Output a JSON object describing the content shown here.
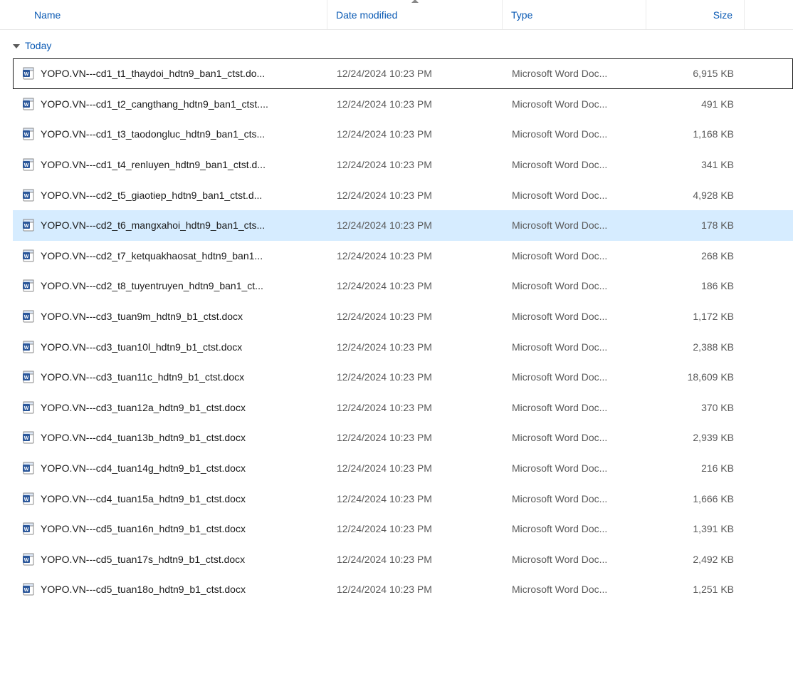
{
  "columns": {
    "name": "Name",
    "date": "Date modified",
    "type": "Type",
    "size": "Size",
    "sorted_column": "date",
    "sort_direction": "asc"
  },
  "group": {
    "label": "Today"
  },
  "file_type_display": "Microsoft Word Doc...",
  "files": [
    {
      "name": "YOPO.VN---cd1_t1_thaydoi_hdtn9_ban1_ctst.do...",
      "date": "12/24/2024 10:23 PM",
      "size": "6,915 KB",
      "state": "selected"
    },
    {
      "name": "YOPO.VN---cd1_t2_cangthang_hdtn9_ban1_ctst....",
      "date": "12/24/2024 10:23 PM",
      "size": "491 KB",
      "state": ""
    },
    {
      "name": "YOPO.VN---cd1_t3_taodongluc_hdtn9_ban1_cts...",
      "date": "12/24/2024 10:23 PM",
      "size": "1,168 KB",
      "state": ""
    },
    {
      "name": "YOPO.VN---cd1_t4_renluyen_hdtn9_ban1_ctst.d...",
      "date": "12/24/2024 10:23 PM",
      "size": "341 KB",
      "state": ""
    },
    {
      "name": "YOPO.VN---cd2_t5_giaotiep_hdtn9_ban1_ctst.d...",
      "date": "12/24/2024 10:23 PM",
      "size": "4,928 KB",
      "state": ""
    },
    {
      "name": "YOPO.VN---cd2_t6_mangxahoi_hdtn9_ban1_cts...",
      "date": "12/24/2024 10:23 PM",
      "size": "178 KB",
      "state": "hovered"
    },
    {
      "name": "YOPO.VN---cd2_t7_ketquakhaosat_hdtn9_ban1...",
      "date": "12/24/2024 10:23 PM",
      "size": "268 KB",
      "state": ""
    },
    {
      "name": "YOPO.VN---cd2_t8_tuyentruyen_hdtn9_ban1_ct...",
      "date": "12/24/2024 10:23 PM",
      "size": "186 KB",
      "state": ""
    },
    {
      "name": "YOPO.VN---cd3_tuan9m_hdtn9_b1_ctst.docx",
      "date": "12/24/2024 10:23 PM",
      "size": "1,172 KB",
      "state": ""
    },
    {
      "name": "YOPO.VN---cd3_tuan10l_hdtn9_b1_ctst.docx",
      "date": "12/24/2024 10:23 PM",
      "size": "2,388 KB",
      "state": ""
    },
    {
      "name": "YOPO.VN---cd3_tuan11c_hdtn9_b1_ctst.docx",
      "date": "12/24/2024 10:23 PM",
      "size": "18,609 KB",
      "state": ""
    },
    {
      "name": "YOPO.VN---cd3_tuan12a_hdtn9_b1_ctst.docx",
      "date": "12/24/2024 10:23 PM",
      "size": "370 KB",
      "state": ""
    },
    {
      "name": "YOPO.VN---cd4_tuan13b_hdtn9_b1_ctst.docx",
      "date": "12/24/2024 10:23 PM",
      "size": "2,939 KB",
      "state": ""
    },
    {
      "name": "YOPO.VN---cd4_tuan14g_hdtn9_b1_ctst.docx",
      "date": "12/24/2024 10:23 PM",
      "size": "216 KB",
      "state": ""
    },
    {
      "name": "YOPO.VN---cd4_tuan15a_hdtn9_b1_ctst.docx",
      "date": "12/24/2024 10:23 PM",
      "size": "1,666 KB",
      "state": ""
    },
    {
      "name": "YOPO.VN---cd5_tuan16n_hdtn9_b1_ctst.docx",
      "date": "12/24/2024 10:23 PM",
      "size": "1,391 KB",
      "state": ""
    },
    {
      "name": "YOPO.VN---cd5_tuan17s_hdtn9_b1_ctst.docx",
      "date": "12/24/2024 10:23 PM",
      "size": "2,492 KB",
      "state": ""
    },
    {
      "name": "YOPO.VN---cd5_tuan18o_hdtn9_b1_ctst.docx",
      "date": "12/24/2024 10:23 PM",
      "size": "1,251 KB",
      "state": ""
    }
  ]
}
